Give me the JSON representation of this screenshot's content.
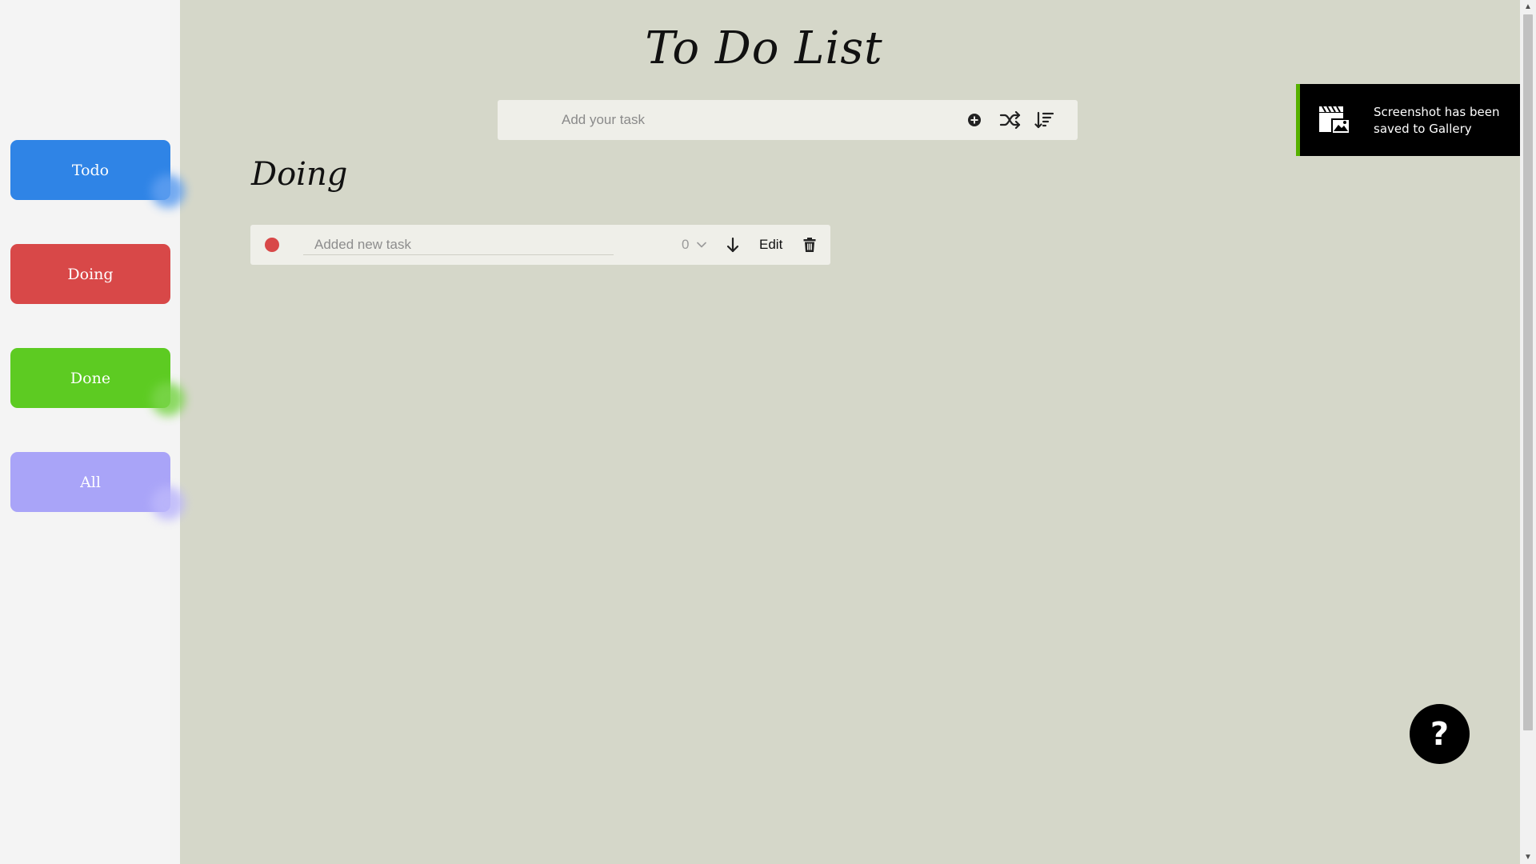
{
  "app": {
    "title": "To Do List"
  },
  "sidebar": {
    "filters": [
      {
        "label": "Todo",
        "color": "#2f84e6"
      },
      {
        "label": "Doing",
        "color": "#d84848"
      },
      {
        "label": "Done",
        "color": "#5dcb22"
      },
      {
        "label": "All",
        "color": "#a9a4f8"
      }
    ]
  },
  "add_bar": {
    "placeholder": "Add your task",
    "icons": [
      "plus-circle-icon",
      "shuffle-icon",
      "sort-icon"
    ]
  },
  "section": {
    "title": "Doing"
  },
  "tasks": [
    {
      "placeholder": "Added new task",
      "status_color": "#d84848",
      "priority": "0",
      "edit_label": "Edit"
    }
  ],
  "toast": {
    "message": "Screenshot has been saved to Gallery",
    "accent": "#56b000"
  },
  "help": {
    "label": "?"
  },
  "colors": {
    "background": "#d5d7c9",
    "sidebar": "#f4f4f4",
    "row": "#efefe9"
  }
}
